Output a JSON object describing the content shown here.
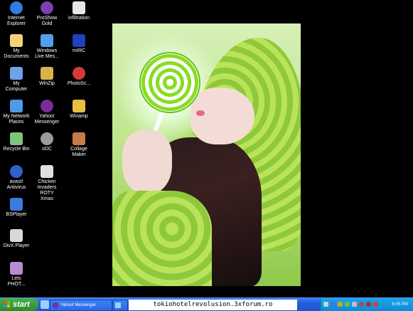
{
  "desktop": {
    "icons": [
      {
        "label": "Internet\nExplorer",
        "icon": "internet-explorer-icon",
        "color": "#2f7de1"
      },
      {
        "label": "ProShow\nGold",
        "icon": "proshow-gold-icon",
        "color": "#7a3fb3"
      },
      {
        "label": "infiltration",
        "icon": "infiltration-icon",
        "color": "#e6e6e6"
      },
      {
        "label": "My\nDocuments",
        "icon": "folder-icon",
        "color": "#f4d27a"
      },
      {
        "label": "Windows\nLive Mes...",
        "icon": "windows-live-messenger-icon",
        "color": "#4fa1e8"
      },
      {
        "label": "mIRC",
        "icon": "mirc-icon",
        "color": "#2040c0"
      },
      {
        "label": "My\nComputer",
        "icon": "computer-icon",
        "color": "#6fa2e8"
      },
      {
        "label": "WinZip",
        "icon": "winzip-icon",
        "color": "#d9b24a"
      },
      {
        "label": "PhotoSc...",
        "icon": "photoscape-icon",
        "color": "#d33a3a"
      },
      {
        "label": "My Network\nPlaces",
        "icon": "network-icon",
        "color": "#4d9be6"
      },
      {
        "label": "Yahoo!\nMessenger",
        "icon": "yahoo-messenger-icon",
        "color": "#7b2c9a"
      },
      {
        "label": "Winamp",
        "icon": "winamp-icon",
        "color": "#e8c040"
      },
      {
        "label": "Recycle Bin",
        "icon": "recycle-bin-icon",
        "color": "#7ec47a"
      },
      {
        "label": "oDC",
        "icon": "odc-icon",
        "color": "#9a9a9a"
      },
      {
        "label": "Collage\nMaker",
        "icon": "collage-maker-icon",
        "color": "#c87a4a"
      },
      {
        "label": "avast!\nAntivirus",
        "icon": "avast-antivirus-icon",
        "color": "#2e63c7"
      },
      {
        "label": "Chicken\nInvaders\nROTY\nXmas",
        "icon": "chicken-invaders-icon",
        "color": "#e0e0e0"
      },
      {
        "label": "BSPlayer",
        "icon": "bsplayer-icon",
        "color": "#3b7be0"
      },
      {
        "label": "DivX Player",
        "icon": "divx-player-icon",
        "color": "#d8d8d8"
      },
      {
        "label": "Lets\nPHOT...",
        "icon": "lets-photo-icon",
        "color": "#b88ad0"
      }
    ]
  },
  "taskbar": {
    "start_label": "start",
    "buttons": [
      {
        "label": "Yahoo! Messenger",
        "icon": "yahoo-messenger-icon"
      },
      {
        "label": "",
        "icon": "window-icon"
      }
    ],
    "clock": "6:05 PM",
    "tray_icons": [
      "volume-icon",
      "network-icon",
      "antivirus-icon",
      "messenger-icon",
      "update-icon",
      "security-icon",
      "shield-icon",
      "alert-icon"
    ]
  },
  "watermark": "tokiohotelrevolusion.3xforum.ro"
}
